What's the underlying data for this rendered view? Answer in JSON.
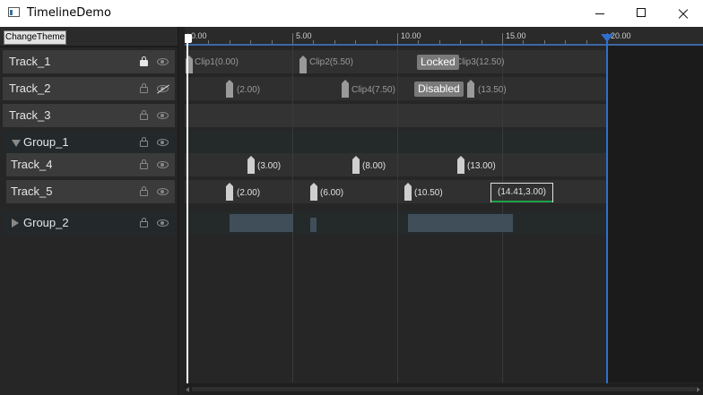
{
  "window": {
    "title": "TimelineDemo"
  },
  "toolbar": {
    "change_theme_label": "ChangeTheme"
  },
  "ruler": {
    "labels": [
      "0.00",
      "5.00",
      "10.00",
      "15.00",
      "20.00"
    ]
  },
  "tracks": [
    {
      "label": "Track_1",
      "locked": true,
      "visible": true
    },
    {
      "label": "Track_2",
      "locked": false,
      "visible": false
    },
    {
      "label": "Track_3",
      "locked": false,
      "visible": true
    },
    {
      "label": "Group_1",
      "group": true,
      "expanded": true
    },
    {
      "label": "Track_4",
      "locked": false,
      "visible": true
    },
    {
      "label": "Track_5",
      "locked": false,
      "visible": true
    },
    {
      "label": "Group_2",
      "group": true,
      "expanded": false
    }
  ],
  "timeline": {
    "playhead_time": 0.0,
    "end_time": 20.0,
    "track1": {
      "clips": [
        "Clip1(0.00)",
        "Clip2(5.50)",
        "Clip3(12.50)"
      ],
      "badge": "Locked"
    },
    "track2": {
      "labels": [
        "(2.00)",
        "Clip4(7.50)",
        "(13.50)"
      ],
      "badge": "Disabled"
    },
    "track4": {
      "labels": [
        "(3.00)",
        "(8.00)",
        "(13.00)"
      ]
    },
    "track5": {
      "labels": [
        "(2.00)",
        "(6.00)",
        "(10.50)"
      ],
      "selected_label": "(14.41,3.00)"
    }
  }
}
